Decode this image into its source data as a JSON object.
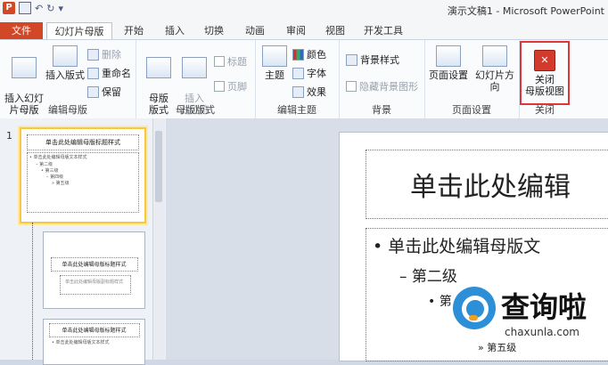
{
  "window": {
    "title": "演示文稿1 - Microsoft PowerPoint",
    "app_badge": "P"
  },
  "tabs": [
    {
      "label": "文件"
    },
    {
      "label": "幻灯片母版"
    },
    {
      "label": "开始"
    },
    {
      "label": "插入"
    },
    {
      "label": "切换"
    },
    {
      "label": "动画"
    },
    {
      "label": "审阅"
    },
    {
      "label": "视图"
    },
    {
      "label": "开发工具"
    }
  ],
  "ribbon": {
    "edit_master": {
      "label": "编辑母版",
      "insert_master": "插入幻灯\n片母版",
      "insert_layout": "插入版式",
      "delete": "删除",
      "rename": "重命名",
      "preserve": "保留"
    },
    "master_layout": {
      "label": "母版版式",
      "master_layout_btn": "母版\n版式",
      "insert_placeholder": "插入\n占位符",
      "title_cb": "标题",
      "footer_cb": "页脚"
    },
    "edit_theme": {
      "label": "编辑主题",
      "theme": "主题",
      "colors": "颜色",
      "fonts": "字体",
      "effects": "效果"
    },
    "background": {
      "label": "背景",
      "bg_styles": "背景样式",
      "hide_bg": "隐藏背景图形"
    },
    "page_setup": {
      "label": "页面设置",
      "page_setup_btn": "页面设置",
      "orientation": "幻灯片方向"
    },
    "close": {
      "label": "关闭",
      "close_btn": "关闭\n母版视图"
    }
  },
  "thumbnails": {
    "slide_number": "1",
    "t1_title": "单击此处编辑母版标题样式",
    "t1_body": [
      "• 单击此处编辑母版文本样式",
      "– 第二级",
      "• 第三级",
      "– 第四级",
      "» 第五级"
    ],
    "t2_title": "单击此处编辑母版标题样式",
    "t2_sub": "单击此处编辑母版副标题样式",
    "t3_title": "单击此处编辑母版标题样式",
    "t3_body": "• 单击此处编辑母版文本样式"
  },
  "slide": {
    "title": "单击此处编辑",
    "level1": "• 单击此处编辑母版文",
    "level2": "– 第二级",
    "level3": "• 第",
    "level5": "» 第五级"
  },
  "watermark": {
    "brand": "查询啦",
    "domain": "chaxunla.com"
  },
  "colors": {
    "file_tab": "#d24726",
    "highlight": "#e0333a",
    "selected_thumb": "#f5c840"
  }
}
